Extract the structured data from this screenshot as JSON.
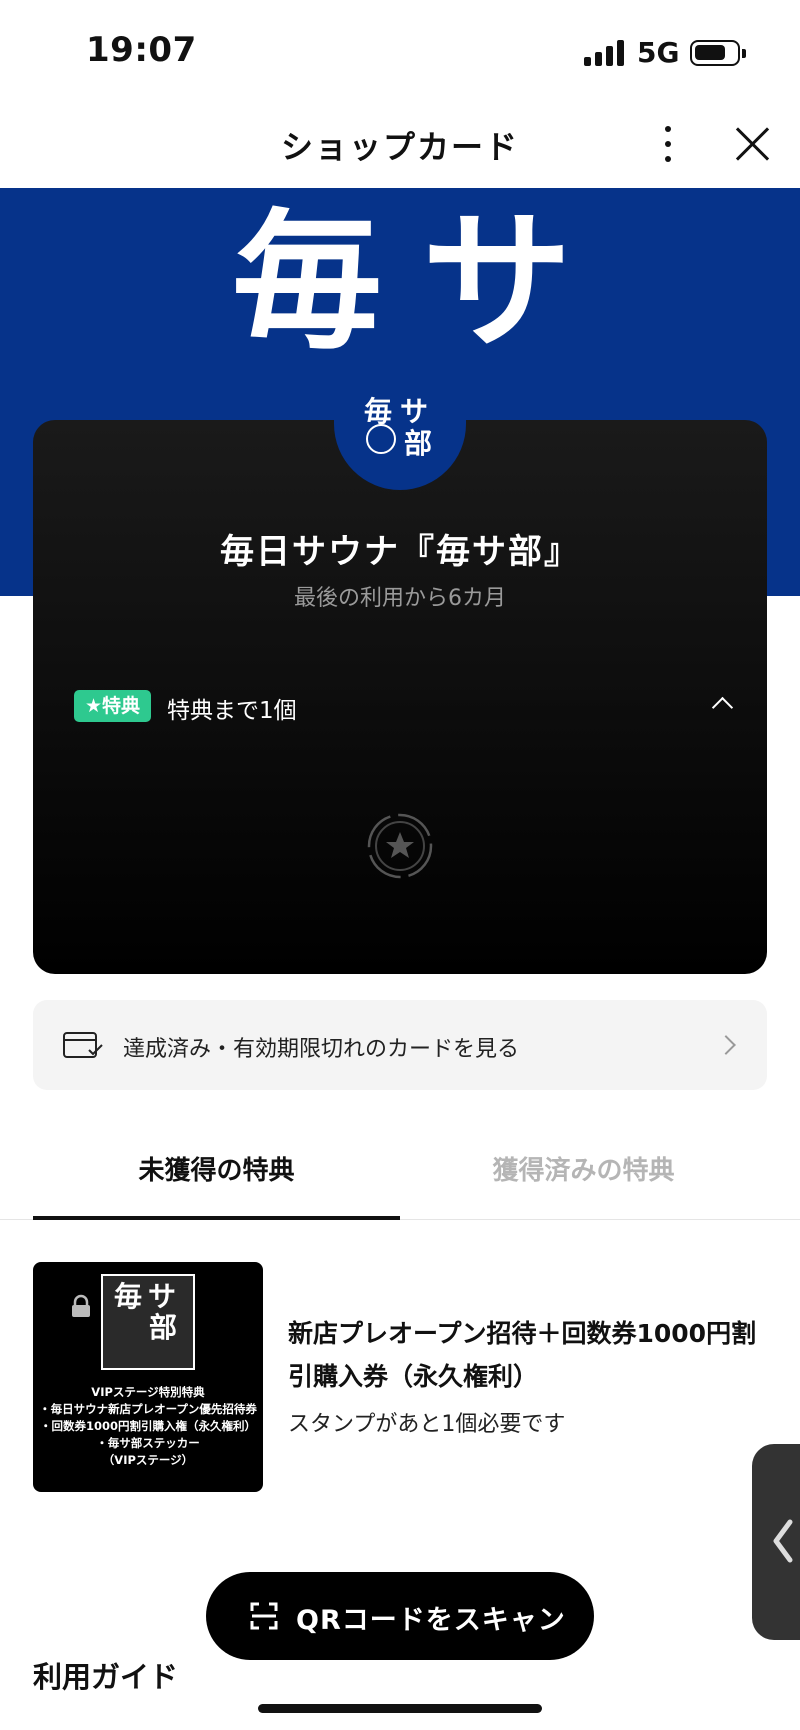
{
  "status_bar": {
    "time": "19:07",
    "network": "5G"
  },
  "header": {
    "title": "ショップカード"
  },
  "banner": {
    "text": "毎サ"
  },
  "logo": {
    "line1": "毎サ",
    "line2": "部"
  },
  "card": {
    "title": "毎日サウナ『毎サ部』",
    "subtitle": "最後の利用から6カ月",
    "badge": "★特典",
    "reward_remaining": "特典まで1個"
  },
  "past_cards": {
    "label": "達成済み・有効期限切れのカードを見る"
  },
  "tabs": [
    {
      "label": "未獲得の特典"
    },
    {
      "label": "獲得済みの特典"
    }
  ],
  "reward": {
    "thumb": {
      "logo_top": "毎サ",
      "logo_bottom": "部",
      "lines": [
        "VIPステージ特別特典",
        "・毎日サウナ新店プレオープン優先招待券",
        "・回数券1000円割引購入権（永久権利）",
        "・毎サ部ステッカー",
        "（VIPステージ）"
      ]
    },
    "title": "新店プレオープン招待＋回数券1000円割引購入券（永久権利）",
    "description": "スタンプがあと1個必要です"
  },
  "scan_button": {
    "label": "QRコードをスキャン"
  },
  "guide": {
    "heading": "利用ガイド"
  },
  "colors": {
    "brand_blue": "#06338a",
    "badge_green": "#2ec98f"
  },
  "icons": [
    "signal-icon",
    "battery-icon",
    "more-icon",
    "close-icon",
    "chevron-up-icon",
    "stamp-star-icon",
    "card-check-icon",
    "chevron-right-icon",
    "lock-icon",
    "scan-icon",
    "chevron-left-icon"
  ]
}
